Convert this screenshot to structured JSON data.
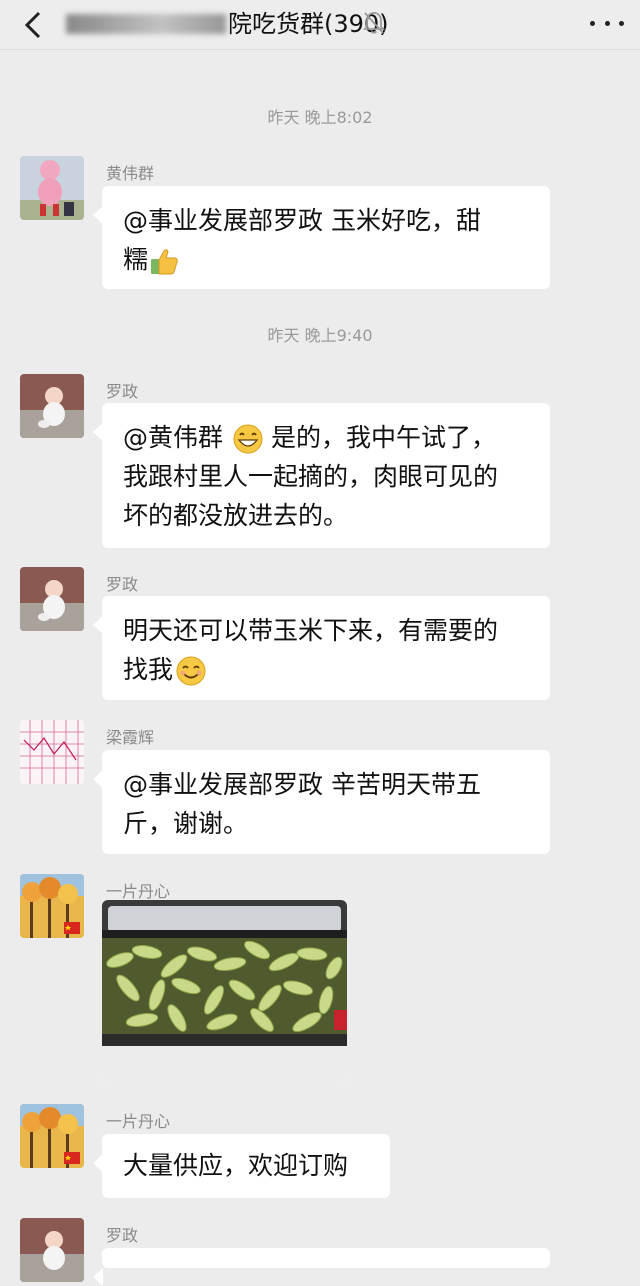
{
  "header": {
    "title_visible": "院吃货群(390)",
    "title_obscured_prefix": "黄",
    "back_icon": "chevron-left-icon",
    "mute_icon": "bell-off-icon",
    "more_icon": "more-dots-icon"
  },
  "timestamps": [
    "昨天 晚上8:02",
    "昨天 晚上9:40"
  ],
  "messages": [
    {
      "sender": "黄伟群",
      "lines": [
        "@事业发展部罗政  玉米好吃，甜",
        "糯"
      ],
      "emoji": "thumbs-up-icon"
    },
    {
      "sender": "罗政",
      "mention": "@黄伟群",
      "lines": [
        "是的，我中午试了，",
        "我跟村里人一起摘的，肉眼可见的",
        "坏的都没放进去的。"
      ],
      "emoji": "grin-icon"
    },
    {
      "sender": "罗政",
      "lines": [
        "明天还可以带玉米下来，有需要的",
        "找我"
      ],
      "emoji": "smile-icon"
    },
    {
      "sender": "梁霞辉",
      "lines": [
        "@事业发展部罗政  辛苦明天带五",
        "斤，谢谢。"
      ]
    },
    {
      "sender": "一片丹心",
      "image": "corn-in-car-trunk-photo"
    },
    {
      "sender": "一片丹心",
      "lines": [
        "大量供应，欢迎订购"
      ]
    },
    {
      "sender": "罗政"
    }
  ],
  "colors": {
    "background": "#ececec",
    "bubble": "#ffffff",
    "timestamp": "#9a9a9a",
    "sender": "#8a8a8a"
  }
}
